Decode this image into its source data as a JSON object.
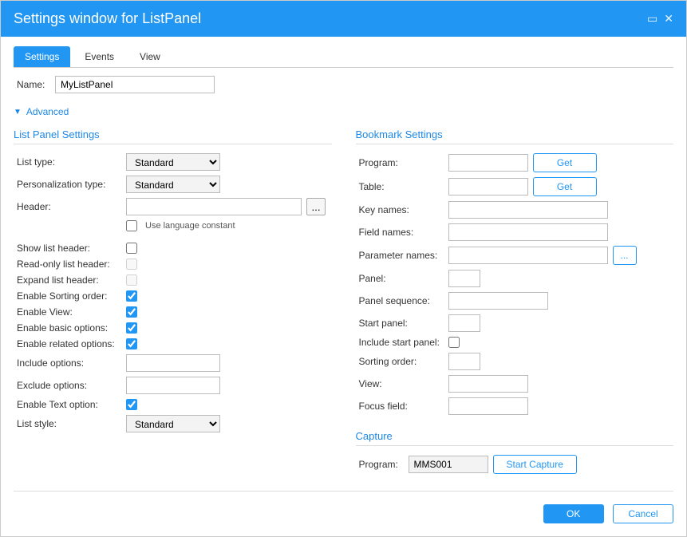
{
  "window": {
    "title": "Settings window for ListPanel"
  },
  "tabs": {
    "settings": "Settings",
    "events": "Events",
    "view": "View"
  },
  "name": {
    "label": "Name:",
    "value": "MyListPanel"
  },
  "advanced": "Advanced",
  "left": {
    "title": "List Panel Settings",
    "listType": {
      "label": "List type:",
      "value": "Standard"
    },
    "persType": {
      "label": "Personalization type:",
      "value": "Standard"
    },
    "header": {
      "label": "Header:",
      "value": "",
      "langConst": "Use language constant"
    },
    "showListHeader": {
      "label": "Show list header:",
      "checked": false
    },
    "readOnlyHeader": {
      "label": "Read-only list header:",
      "checked": false
    },
    "expandHeader": {
      "label": "Expand list header:",
      "checked": false
    },
    "enableSorting": {
      "label": "Enable Sorting order:",
      "checked": true
    },
    "enableView": {
      "label": "Enable View:",
      "checked": true
    },
    "enableBasic": {
      "label": "Enable basic options:",
      "checked": true
    },
    "enableRelated": {
      "label": "Enable related options:",
      "checked": true
    },
    "includeOpts": {
      "label": "Include options:",
      "value": ""
    },
    "excludeOpts": {
      "label": "Exclude options:",
      "value": ""
    },
    "enableText": {
      "label": "Enable Text option:",
      "checked": true
    },
    "listStyle": {
      "label": "List style:",
      "value": "Standard"
    }
  },
  "right": {
    "title": "Bookmark Settings",
    "program": {
      "label": "Program:",
      "value": "",
      "get": "Get"
    },
    "table": {
      "label": "Table:",
      "value": "",
      "get": "Get"
    },
    "keyNames": {
      "label": "Key names:",
      "value": ""
    },
    "fieldNames": {
      "label": "Field names:",
      "value": ""
    },
    "paramNames": {
      "label": "Parameter names:",
      "value": "",
      "btn": "..."
    },
    "panel": {
      "label": "Panel:",
      "value": ""
    },
    "panelSeq": {
      "label": "Panel sequence:",
      "value": ""
    },
    "startPanel": {
      "label": "Start panel:",
      "value": ""
    },
    "includeStart": {
      "label": "Include start panel:",
      "checked": false
    },
    "sortingOrder": {
      "label": "Sorting order:",
      "value": ""
    },
    "view": {
      "label": "View:",
      "value": ""
    },
    "focusField": {
      "label": "Focus field:",
      "value": ""
    }
  },
  "capture": {
    "title": "Capture",
    "program": {
      "label": "Program:",
      "value": "MMS001"
    },
    "start": "Start Capture"
  },
  "footer": {
    "ok": "OK",
    "cancel": "Cancel"
  }
}
